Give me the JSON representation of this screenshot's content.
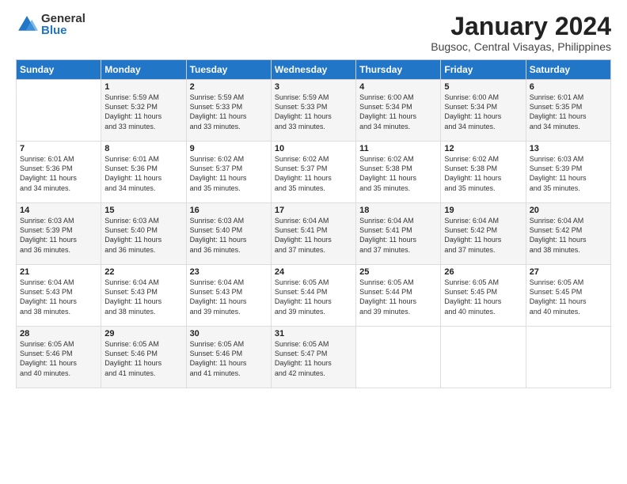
{
  "header": {
    "logo": {
      "general": "General",
      "blue": "Blue"
    },
    "title": "January 2024",
    "location": "Bugsoc, Central Visayas, Philippines"
  },
  "calendar": {
    "days_of_week": [
      "Sunday",
      "Monday",
      "Tuesday",
      "Wednesday",
      "Thursday",
      "Friday",
      "Saturday"
    ],
    "weeks": [
      [
        {
          "day": "",
          "content": ""
        },
        {
          "day": "1",
          "content": "Sunrise: 5:59 AM\nSunset: 5:32 PM\nDaylight: 11 hours\nand 33 minutes."
        },
        {
          "day": "2",
          "content": "Sunrise: 5:59 AM\nSunset: 5:33 PM\nDaylight: 11 hours\nand 33 minutes."
        },
        {
          "day": "3",
          "content": "Sunrise: 5:59 AM\nSunset: 5:33 PM\nDaylight: 11 hours\nand 33 minutes."
        },
        {
          "day": "4",
          "content": "Sunrise: 6:00 AM\nSunset: 5:34 PM\nDaylight: 11 hours\nand 34 minutes."
        },
        {
          "day": "5",
          "content": "Sunrise: 6:00 AM\nSunset: 5:34 PM\nDaylight: 11 hours\nand 34 minutes."
        },
        {
          "day": "6",
          "content": "Sunrise: 6:01 AM\nSunset: 5:35 PM\nDaylight: 11 hours\nand 34 minutes."
        }
      ],
      [
        {
          "day": "7",
          "content": "Sunrise: 6:01 AM\nSunset: 5:36 PM\nDaylight: 11 hours\nand 34 minutes."
        },
        {
          "day": "8",
          "content": "Sunrise: 6:01 AM\nSunset: 5:36 PM\nDaylight: 11 hours\nand 34 minutes."
        },
        {
          "day": "9",
          "content": "Sunrise: 6:02 AM\nSunset: 5:37 PM\nDaylight: 11 hours\nand 35 minutes."
        },
        {
          "day": "10",
          "content": "Sunrise: 6:02 AM\nSunset: 5:37 PM\nDaylight: 11 hours\nand 35 minutes."
        },
        {
          "day": "11",
          "content": "Sunrise: 6:02 AM\nSunset: 5:38 PM\nDaylight: 11 hours\nand 35 minutes."
        },
        {
          "day": "12",
          "content": "Sunrise: 6:02 AM\nSunset: 5:38 PM\nDaylight: 11 hours\nand 35 minutes."
        },
        {
          "day": "13",
          "content": "Sunrise: 6:03 AM\nSunset: 5:39 PM\nDaylight: 11 hours\nand 35 minutes."
        }
      ],
      [
        {
          "day": "14",
          "content": "Sunrise: 6:03 AM\nSunset: 5:39 PM\nDaylight: 11 hours\nand 36 minutes."
        },
        {
          "day": "15",
          "content": "Sunrise: 6:03 AM\nSunset: 5:40 PM\nDaylight: 11 hours\nand 36 minutes."
        },
        {
          "day": "16",
          "content": "Sunrise: 6:03 AM\nSunset: 5:40 PM\nDaylight: 11 hours\nand 36 minutes."
        },
        {
          "day": "17",
          "content": "Sunrise: 6:04 AM\nSunset: 5:41 PM\nDaylight: 11 hours\nand 37 minutes."
        },
        {
          "day": "18",
          "content": "Sunrise: 6:04 AM\nSunset: 5:41 PM\nDaylight: 11 hours\nand 37 minutes."
        },
        {
          "day": "19",
          "content": "Sunrise: 6:04 AM\nSunset: 5:42 PM\nDaylight: 11 hours\nand 37 minutes."
        },
        {
          "day": "20",
          "content": "Sunrise: 6:04 AM\nSunset: 5:42 PM\nDaylight: 11 hours\nand 38 minutes."
        }
      ],
      [
        {
          "day": "21",
          "content": "Sunrise: 6:04 AM\nSunset: 5:43 PM\nDaylight: 11 hours\nand 38 minutes."
        },
        {
          "day": "22",
          "content": "Sunrise: 6:04 AM\nSunset: 5:43 PM\nDaylight: 11 hours\nand 38 minutes."
        },
        {
          "day": "23",
          "content": "Sunrise: 6:04 AM\nSunset: 5:43 PM\nDaylight: 11 hours\nand 39 minutes."
        },
        {
          "day": "24",
          "content": "Sunrise: 6:05 AM\nSunset: 5:44 PM\nDaylight: 11 hours\nand 39 minutes."
        },
        {
          "day": "25",
          "content": "Sunrise: 6:05 AM\nSunset: 5:44 PM\nDaylight: 11 hours\nand 39 minutes."
        },
        {
          "day": "26",
          "content": "Sunrise: 6:05 AM\nSunset: 5:45 PM\nDaylight: 11 hours\nand 40 minutes."
        },
        {
          "day": "27",
          "content": "Sunrise: 6:05 AM\nSunset: 5:45 PM\nDaylight: 11 hours\nand 40 minutes."
        }
      ],
      [
        {
          "day": "28",
          "content": "Sunrise: 6:05 AM\nSunset: 5:46 PM\nDaylight: 11 hours\nand 40 minutes."
        },
        {
          "day": "29",
          "content": "Sunrise: 6:05 AM\nSunset: 5:46 PM\nDaylight: 11 hours\nand 41 minutes."
        },
        {
          "day": "30",
          "content": "Sunrise: 6:05 AM\nSunset: 5:46 PM\nDaylight: 11 hours\nand 41 minutes."
        },
        {
          "day": "31",
          "content": "Sunrise: 6:05 AM\nSunset: 5:47 PM\nDaylight: 11 hours\nand 42 minutes."
        },
        {
          "day": "",
          "content": ""
        },
        {
          "day": "",
          "content": ""
        },
        {
          "day": "",
          "content": ""
        }
      ]
    ]
  }
}
